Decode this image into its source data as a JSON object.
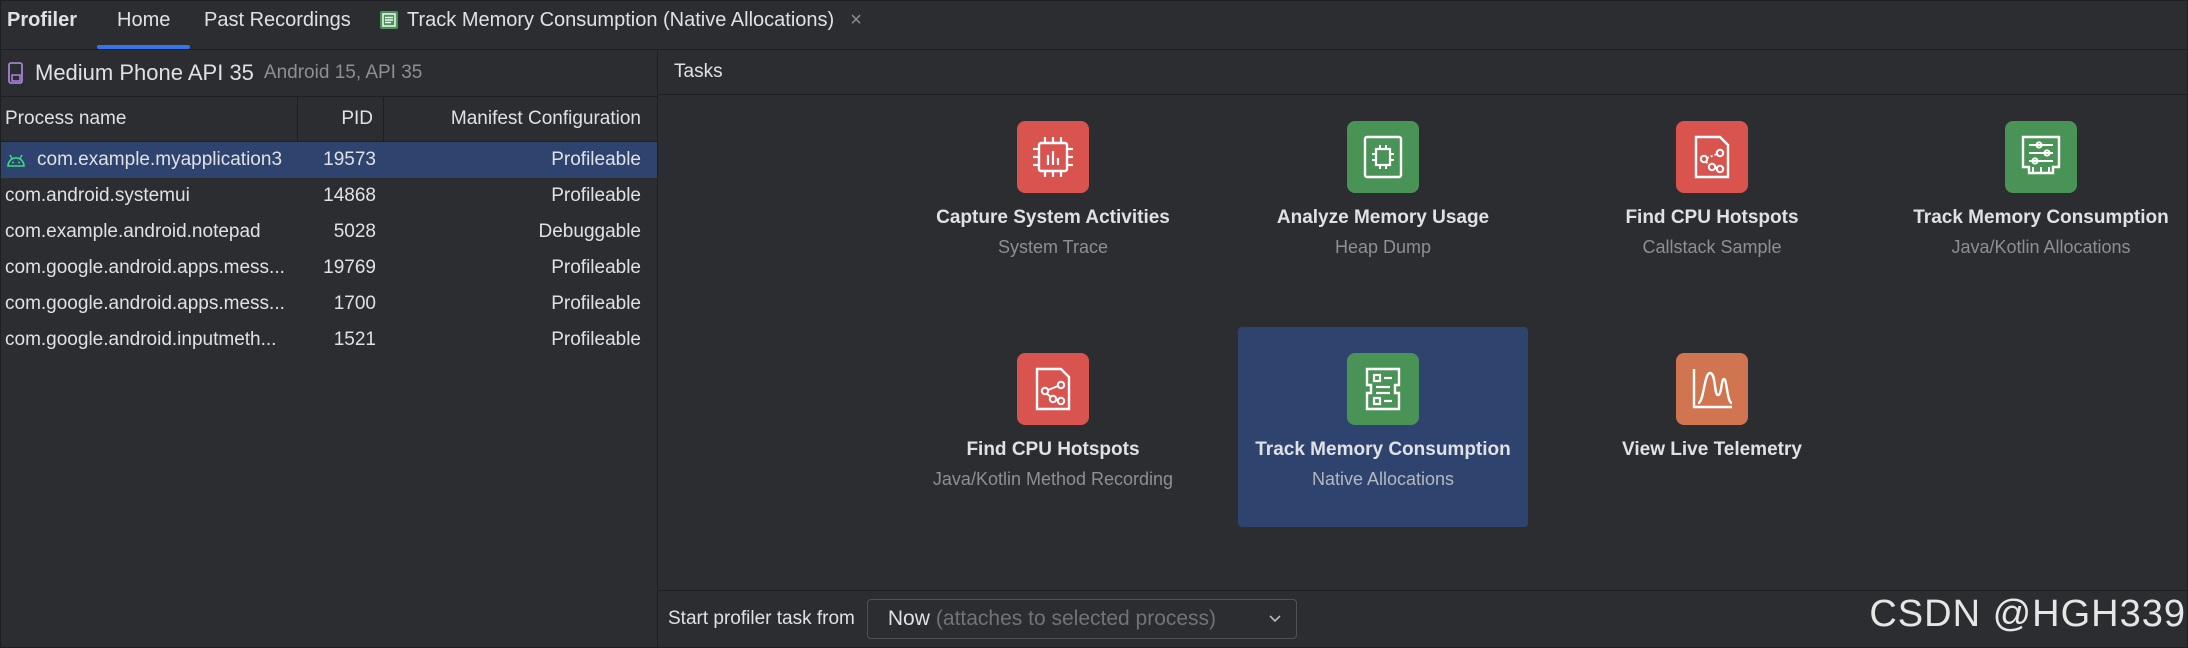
{
  "app_title": "Profiler",
  "tabs": [
    {
      "label": "Home"
    },
    {
      "label": "Past Recordings"
    },
    {
      "label": "Track Memory Consumption (Native Allocations)",
      "close": "×"
    }
  ],
  "device": {
    "name": "Medium Phone API 35",
    "sub": "Android 15, API 35"
  },
  "process_table": {
    "columns": [
      "Process name",
      "PID",
      "Manifest Configuration"
    ],
    "rows": [
      {
        "name": "com.example.myapplication3",
        "pid": "19573",
        "manifest": "Profileable",
        "selected": true
      },
      {
        "name": "com.android.systemui",
        "pid": "14868",
        "manifest": "Profileable"
      },
      {
        "name": "com.example.android.notepad",
        "pid": "5028",
        "manifest": "Debuggable"
      },
      {
        "name": "com.google.android.apps.mess...",
        "pid": "19769",
        "manifest": "Profileable"
      },
      {
        "name": "com.google.android.apps.mess...",
        "pid": "1700",
        "manifest": "Profileable"
      },
      {
        "name": "com.google.android.inputmeth...",
        "pid": "1521",
        "manifest": "Profileable"
      }
    ]
  },
  "tasks_header": "Tasks",
  "tasks": [
    {
      "title": "Capture System Activities",
      "subtitle": "System Trace",
      "icon": "system-trace-icon",
      "color": "#d9534f"
    },
    {
      "title": "Analyze Memory Usage",
      "subtitle": "Heap Dump",
      "icon": "heap-dump-icon",
      "color": "#4a9356"
    },
    {
      "title": "Find CPU Hotspots",
      "subtitle": "Callstack Sample",
      "icon": "callstack-sample-icon",
      "color": "#d9534f"
    },
    {
      "title": "Track Memory Consumption",
      "subtitle": "Java/Kotlin Allocations",
      "icon": "java-allocations-icon",
      "color": "#4a9356"
    },
    {
      "title": "Find CPU Hotspots",
      "subtitle": "Java/Kotlin Method Recording",
      "icon": "method-recording-icon",
      "color": "#d9534f"
    },
    {
      "title": "Track Memory Consumption",
      "subtitle": "Native Allocations",
      "icon": "native-allocations-icon",
      "color": "#4a9356",
      "selected": true
    },
    {
      "title": "View Live Telemetry",
      "subtitle": "",
      "icon": "live-telemetry-icon",
      "color": "#d07550"
    }
  ],
  "footer": {
    "label": "Start profiler task from",
    "select_value": "Now",
    "select_hint": "(attaches to selected process)"
  },
  "watermark": "CSDN @HGH339",
  "colors": {
    "accent": "#3574f0",
    "selection": "#2e436e",
    "background": "#2b2d30"
  }
}
